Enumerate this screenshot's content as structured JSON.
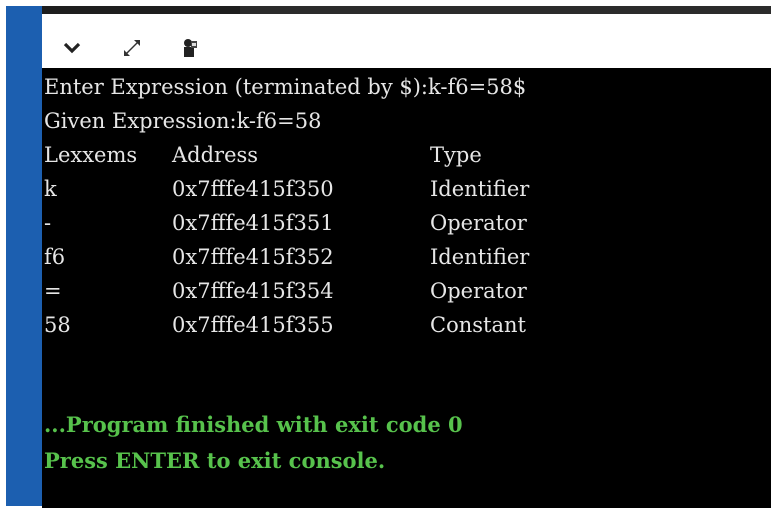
{
  "toolbar": {
    "icons": [
      "chevron-down-icon",
      "expand-icon",
      "settings-icon"
    ]
  },
  "console": {
    "prompt_line": "Enter Expression (terminated by $):k-f6=58$",
    "given_line": "Given Expression:k-f6=58",
    "table": {
      "headers": [
        "Lexxems",
        "Address",
        "Type"
      ],
      "rows": [
        {
          "lexeme": "k",
          "address": "0x7fffe415f350",
          "type": "Identifier"
        },
        {
          "lexeme": "-",
          "address": "0x7fffe415f351",
          "type": "Operator"
        },
        {
          "lexeme": "f6",
          "address": "0x7fffe415f352",
          "type": "Identifier"
        },
        {
          "lexeme": "=",
          "address": "0x7fffe415f354",
          "type": "Operator"
        },
        {
          "lexeme": "58",
          "address": "0x7fffe415f355",
          "type": "Constant"
        }
      ]
    },
    "finish_line": "...Program finished with exit code 0",
    "press_line": "Press ENTER to exit console."
  },
  "colors": {
    "accent_blue": "#1c5fb0",
    "console_bg": "#000000",
    "console_text": "#e6e6e6",
    "status_green": "#57c24c"
  }
}
